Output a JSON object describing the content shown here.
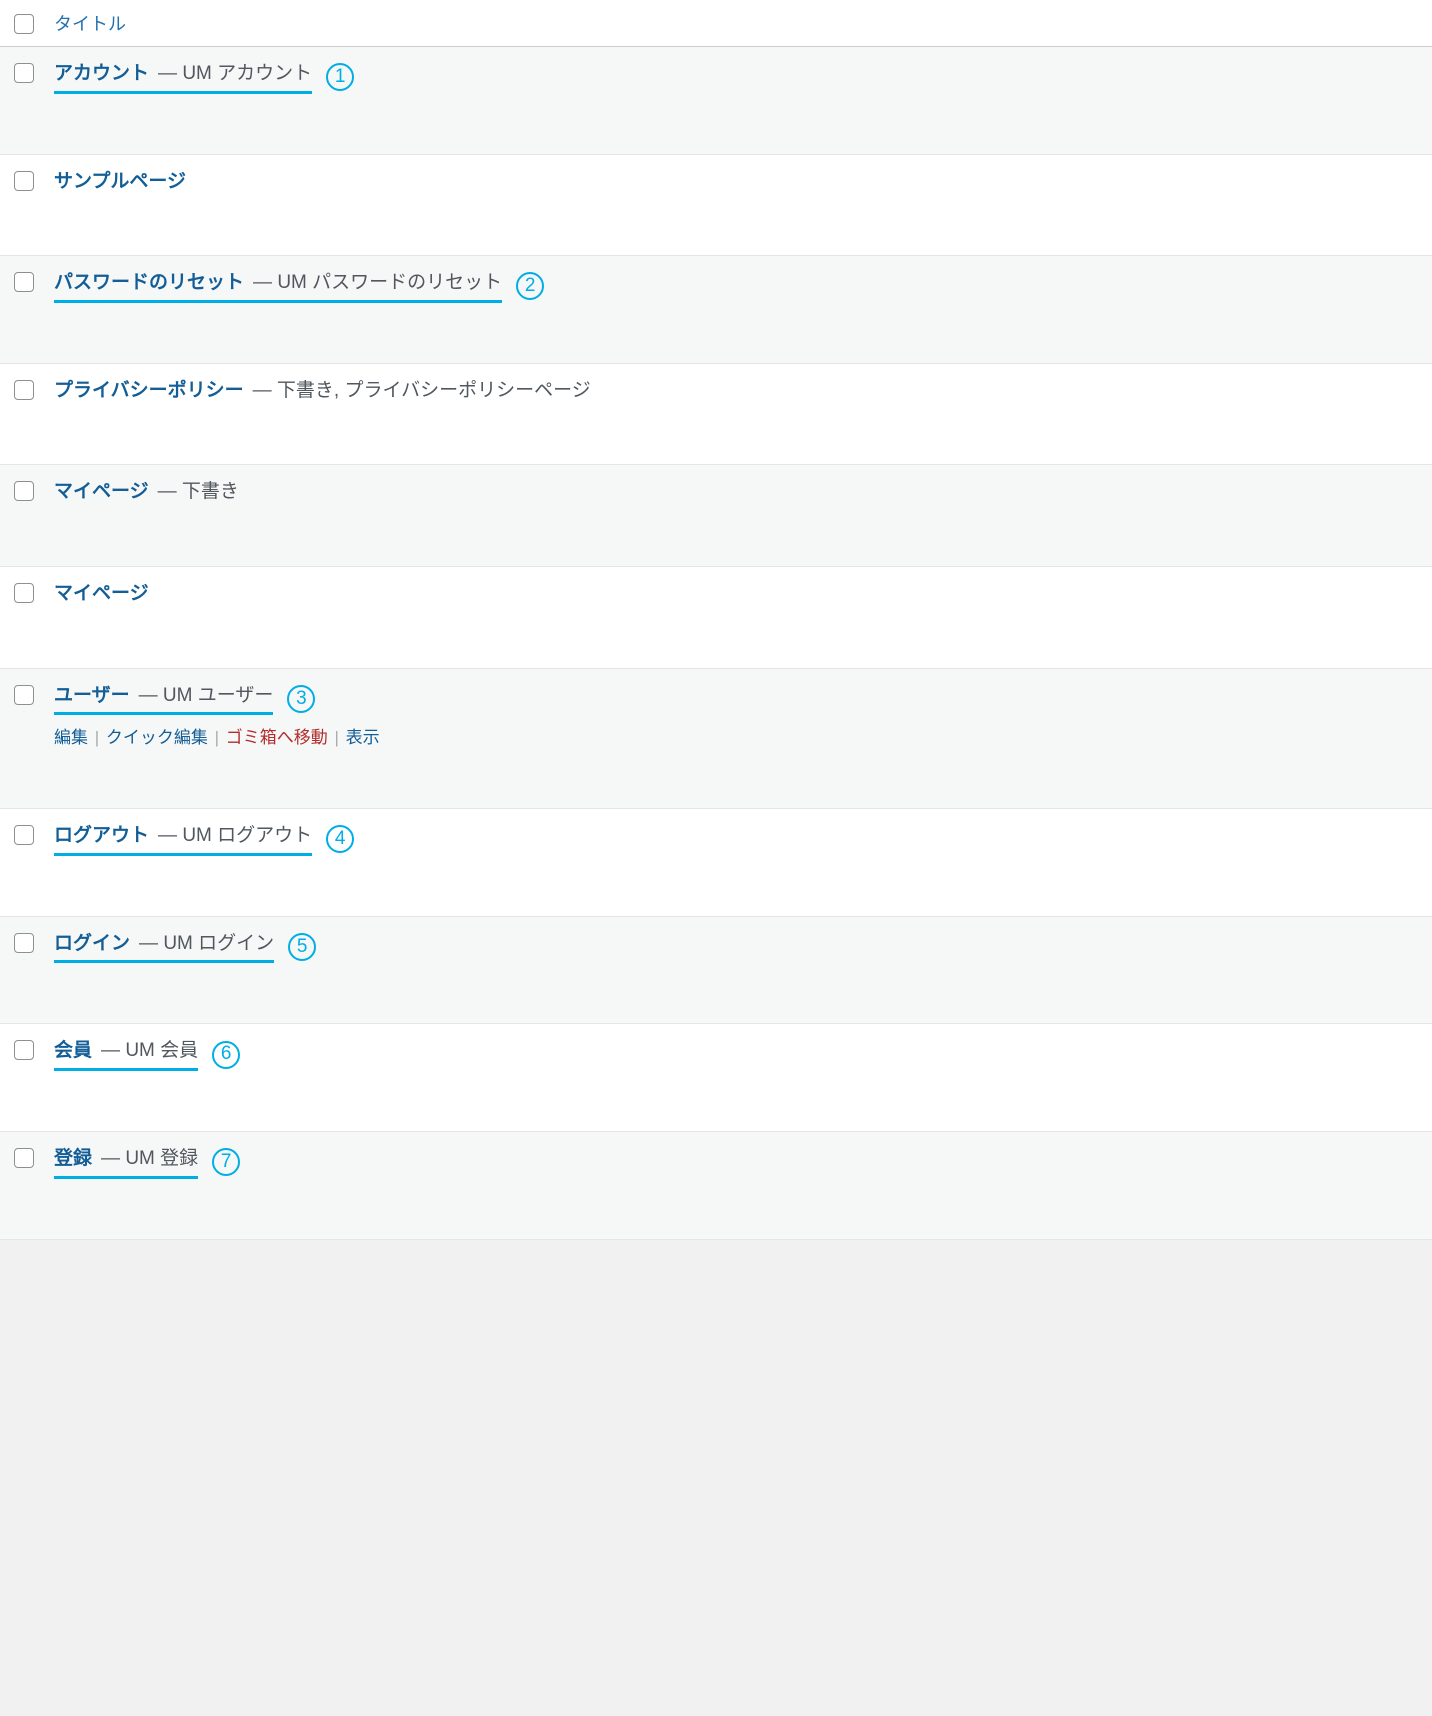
{
  "header": {
    "title_col": "タイトル"
  },
  "suffix_dash": "—",
  "actions": {
    "edit": "編集",
    "quick_edit": "クイック編集",
    "trash": "ゴミ箱へ移動",
    "view": "表示"
  },
  "rows": [
    {
      "title": "アカウント",
      "suffix": "UM アカウント",
      "badge": "1",
      "underline": true,
      "show_actions": false
    },
    {
      "title": "サンプルページ",
      "suffix": "",
      "badge": "",
      "underline": false,
      "show_actions": false
    },
    {
      "title": "パスワードのリセット",
      "suffix": "UM パスワードのリセット",
      "badge": "2",
      "underline": true,
      "show_actions": false
    },
    {
      "title": "プライバシーポリシー",
      "suffix": "下書き, プライバシーポリシーページ",
      "badge": "",
      "underline": false,
      "show_actions": false
    },
    {
      "title": "マイページ",
      "suffix": "下書き",
      "badge": "",
      "underline": false,
      "show_actions": false
    },
    {
      "title": "マイページ",
      "suffix": "",
      "badge": "",
      "underline": false,
      "show_actions": false
    },
    {
      "title": "ユーザー",
      "suffix": "UM ユーザー",
      "badge": "3",
      "underline": true,
      "show_actions": true
    },
    {
      "title": "ログアウト",
      "suffix": "UM ログアウト",
      "badge": "4",
      "underline": true,
      "show_actions": false
    },
    {
      "title": "ログイン",
      "suffix": "UM ログイン",
      "badge": "5",
      "underline": true,
      "show_actions": false
    },
    {
      "title": "会員",
      "suffix": "UM 会員",
      "badge": "6",
      "underline": true,
      "show_actions": false
    },
    {
      "title": "登録",
      "suffix": "UM 登録",
      "badge": "7",
      "underline": true,
      "show_actions": false
    }
  ]
}
